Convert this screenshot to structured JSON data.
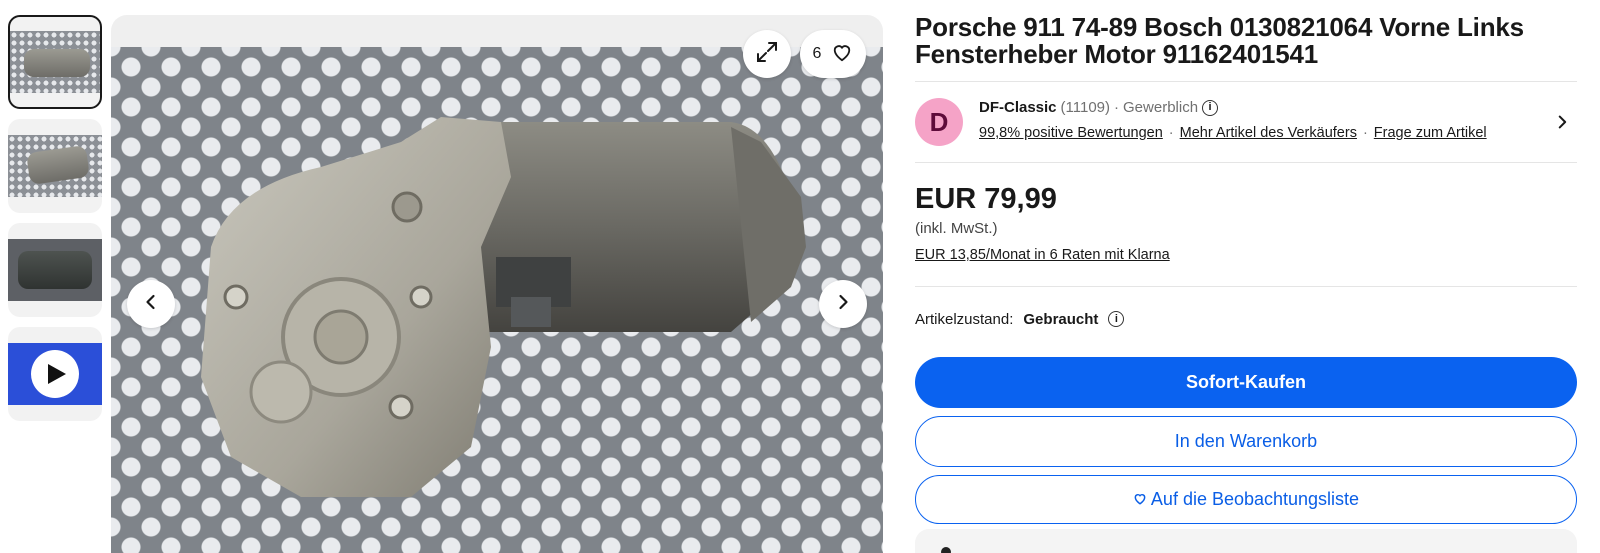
{
  "gallery": {
    "thumbnails": [
      {
        "name": "thumb-1",
        "kind": "image",
        "selected": true
      },
      {
        "name": "thumb-2",
        "kind": "image",
        "selected": false
      },
      {
        "name": "thumb-3",
        "kind": "image",
        "selected": false
      },
      {
        "name": "thumb-4",
        "kind": "video",
        "selected": false
      }
    ],
    "watch_count": "6",
    "icons": {
      "prev": "chevron-left-icon",
      "next": "chevron-right-icon",
      "expand": "expand-icon",
      "watch": "heart-icon",
      "play": "play-icon"
    }
  },
  "listing": {
    "title": "Porsche 911 74-89 Bosch 0130821064 Vorne Links Fensterheber Motor 91162401541"
  },
  "seller": {
    "avatar_letter": "D",
    "name": "DF-Classic",
    "rating_count": "(11109)",
    "dot": "·",
    "type": "Gewerblich",
    "feedback": "99,8% positive Bewertungen",
    "more_items": "Mehr Artikel des Verkäufers",
    "contact": "Frage zum Artikel"
  },
  "price": {
    "amount": "EUR 79,99",
    "vat_note": "(inkl. MwSt.)",
    "installment": "EUR 13,85/Monat in 6 Raten mit Klarna"
  },
  "condition": {
    "label": "Artikelzustand:",
    "value": "Gebraucht"
  },
  "actions": {
    "buy_now": "Sofort-Kaufen",
    "add_to_cart": "In den Warenkorb",
    "watchlist": "Auf die Beobachtungsliste"
  },
  "colors": {
    "primary": "#0a62f0",
    "avatar_bg": "#f5a3c7",
    "avatar_fg": "#5e0b3a",
    "text": "#191919"
  }
}
